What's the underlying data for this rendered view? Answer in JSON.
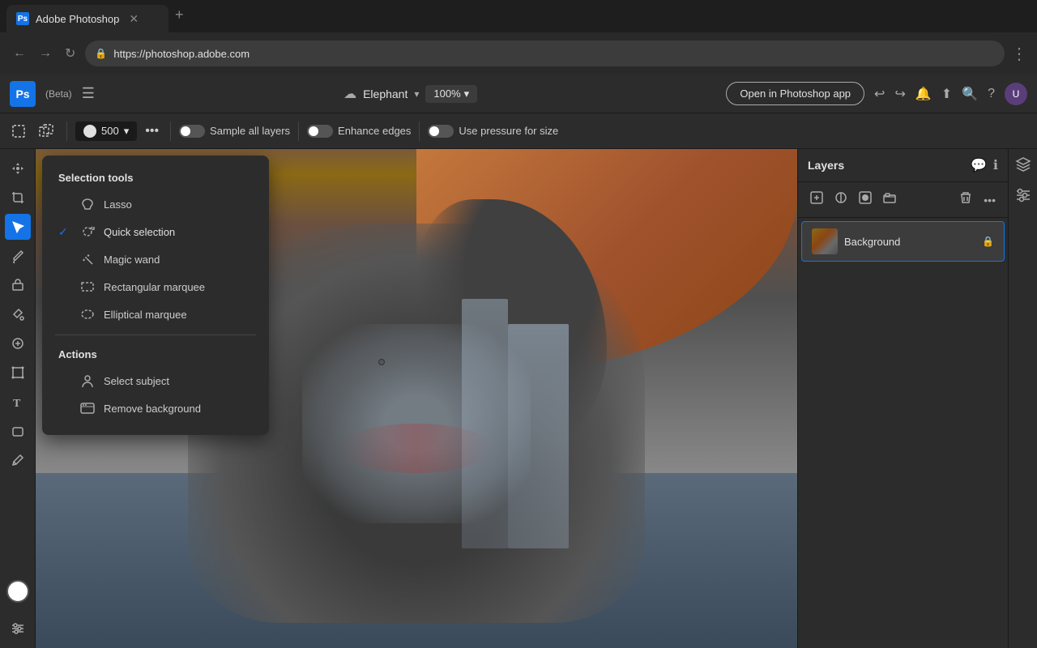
{
  "browser": {
    "tab_title": "Adobe Photoshop",
    "tab_favicon": "Ps",
    "url": "https://photoshop.adobe.com",
    "new_tab_label": "+"
  },
  "app_header": {
    "logo": "Ps",
    "beta_label": "(Beta)",
    "hamburger": "☰",
    "file_name": "Elephant",
    "zoom_value": "100%",
    "open_in_photoshop": "Open in Photoshop app",
    "undo_icon": "↩",
    "redo_icon": "↪"
  },
  "toolbar": {
    "size_value": "500",
    "more_label": "•••",
    "sample_all_layers": "Sample all layers",
    "enhance_edges": "Enhance edges",
    "use_pressure": "Use pressure for size"
  },
  "selection_popup": {
    "section_title": "Selection tools",
    "items": [
      {
        "label": "Lasso",
        "icon": "lasso",
        "checked": false
      },
      {
        "label": "Quick selection",
        "icon": "quick",
        "checked": true
      },
      {
        "label": "Magic wand",
        "icon": "wand",
        "checked": false
      },
      {
        "label": "Rectangular marquee",
        "icon": "rect",
        "checked": false
      },
      {
        "label": "Elliptical marquee",
        "icon": "ellipse",
        "checked": false
      }
    ],
    "actions_title": "Actions",
    "actions": [
      {
        "label": "Select subject",
        "icon": "person"
      },
      {
        "label": "Remove background",
        "icon": "image"
      }
    ]
  },
  "layers_panel": {
    "title": "Layers",
    "layer_name": "Background"
  },
  "colors": {
    "active_blue": "#1473e6",
    "bg_dark": "#2c2c2c",
    "bg_darker": "#1a1a1a",
    "text_light": "#e0e0e0",
    "text_muted": "#aaa"
  }
}
